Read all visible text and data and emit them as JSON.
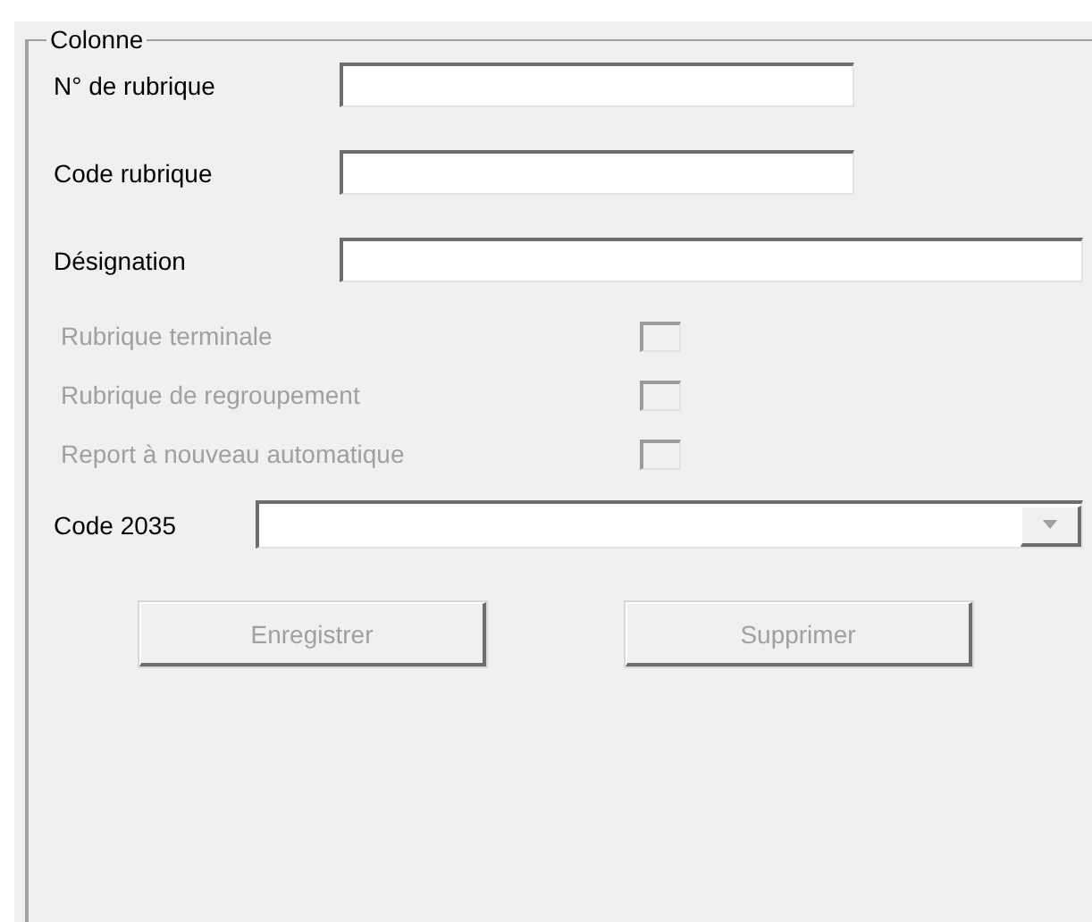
{
  "group": {
    "title": "Colonne"
  },
  "fields": [
    {
      "label": "N° de rubrique",
      "kind": "short"
    },
    {
      "label": "Code rubrique",
      "kind": "short"
    },
    {
      "label": "Désignation",
      "kind": "long"
    }
  ],
  "checkboxes": [
    {
      "label": "Rubrique terminale",
      "checked": false,
      "disabled": true
    },
    {
      "label": "Rubrique de regroupement",
      "checked": false,
      "disabled": true
    },
    {
      "label": "Report à nouveau automatique",
      "checked": false,
      "disabled": true
    }
  ],
  "combo": {
    "label": "Code 2035"
  },
  "buttons": [
    {
      "label": "Enregistrer",
      "disabled": true
    },
    {
      "label": "Supprimer",
      "disabled": true
    }
  ]
}
